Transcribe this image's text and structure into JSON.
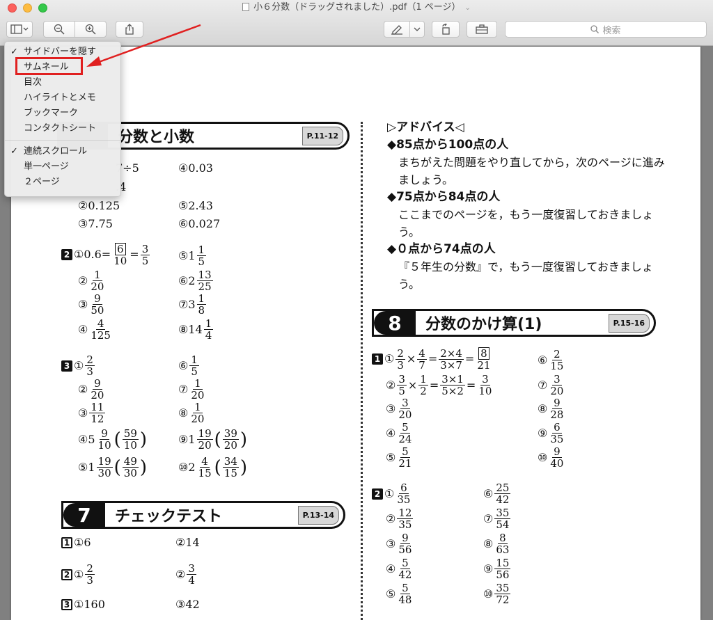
{
  "window": {
    "title": "小６分数（ドラッグされました）.pdf（1 ページ）"
  },
  "toolbar": {
    "search_placeholder": "検索"
  },
  "menu": {
    "items": [
      {
        "label": "サイドバーを隠す",
        "checked": true
      },
      {
        "label": "サムネール",
        "checked": false
      },
      {
        "label": "目次",
        "checked": false
      },
      {
        "label": "ハイライトとメモ",
        "checked": false
      },
      {
        "label": "ブックマーク",
        "checked": false
      },
      {
        "label": "コンタクトシート",
        "checked": false
      },
      {
        "label": "連続スクロール",
        "checked": true
      },
      {
        "label": "単一ページ",
        "checked": false
      },
      {
        "label": "２ページ",
        "checked": false
      }
    ],
    "check_mark": "✓"
  },
  "doc": {
    "sec6": {
      "title": "分数と小数",
      "page": "P.11-12"
    },
    "sec7": {
      "num": "7",
      "title": "チェックテスト",
      "page": "P.13-14"
    },
    "sec8": {
      "num": "8",
      "title": "分数のかけ算(1)",
      "page": "P.15-16"
    },
    "q1_top": {
      "a1": "7÷5",
      "a2": ".4",
      "a4": "④0.03",
      "b2": "②0.125",
      "b5": "⑤2.43",
      "c3": "③7.75",
      "c6": "⑥0.027"
    },
    "q2": {
      "num": "2",
      "l1": "①0.6=",
      "f1n": "6",
      "f1d": "10",
      "eq": "=",
      "f2n": "3",
      "f2d": "5",
      "r5": "⑤1",
      "r5n": "1",
      "r5d": "5",
      "l2": "②",
      "f3n": "1",
      "f3d": "20",
      "r6": "⑥2",
      "r6n": "13",
      "r6d": "25",
      "l3": "③",
      "f4n": "9",
      "f4d": "50",
      "r7": "⑦3",
      "r7n": "1",
      "r7d": "8",
      "l4": "④",
      "f5n": "4",
      "f5d": "125",
      "r8": "⑧14",
      "r8n": "1",
      "r8d": "4"
    },
    "q3": {
      "num": "3",
      "l1": "①",
      "a1n": "2",
      "a1d": "3",
      "r6": "⑥",
      "r6n": "1",
      "r6d": "5",
      "l2": "②",
      "a2n": "9",
      "a2d": "20",
      "r7": "⑦",
      "r7n": "1",
      "r7d": "20",
      "l3": "③",
      "a3n": "11",
      "a3d": "12",
      "r8": "⑧",
      "r8n": "1",
      "r8d": "20",
      "l4": "④5",
      "a4n": "9",
      "a4d": "10",
      "a4pn": "59",
      "a4pd": "10",
      "r9": "⑨1",
      "r9n": "19",
      "r9d": "20",
      "r9pn": "39",
      "r9pd": "20",
      "l5": "⑤1",
      "a5n": "19",
      "a5d": "30",
      "a5pn": "49",
      "a5pd": "30",
      "r10": "⑩2",
      "r10n": "4",
      "r10d": "15",
      "r10pn": "34",
      "r10pd": "15"
    },
    "q7": {
      "n1": "1",
      "a1": "①6",
      "a2": "②14",
      "n2": "2",
      "b1": "①",
      "b1n": "2",
      "b1d": "3",
      "b2": "②",
      "b2n": "3",
      "b2d": "4",
      "n3": "3",
      "c1": "①160",
      "c3": "③42"
    },
    "advice": {
      "title": "▷アドバイス◁",
      "h1": "◆85点から100点の人",
      "t1": "まちがえた問題をやり直してから，次のページに進みましょう。",
      "h2": "◆75点から84点の人",
      "t2": "ここまでのページを，もう一度復習しておきましょう。",
      "h3": "◆０点から74点の人",
      "t3": "『５年生の分数』で，もう一度復習しておきましょう。"
    },
    "q8_1": {
      "num": "1",
      "l1": "①",
      "e1": [
        "2",
        "3",
        "4",
        "7",
        "2×4",
        "3×7",
        "8",
        "21"
      ],
      "l2": "②",
      "e2": [
        "3",
        "5",
        "1",
        "2",
        "3×1",
        "5×2",
        "3",
        "10"
      ],
      "l3": "③",
      "f3n": "3",
      "f3d": "20",
      "l4": "④",
      "f4n": "5",
      "f4d": "24",
      "l5": "⑤",
      "f5n": "5",
      "f5d": "21",
      "r6": "⑥",
      "r6n": "2",
      "r6d": "15",
      "r7": "⑦",
      "r7n": "3",
      "r7d": "20",
      "r8": "⑧",
      "r8n": "9",
      "r8d": "28",
      "r9": "⑨",
      "r9n": "6",
      "r9d": "35",
      "r10": "⑩",
      "r10n": "9",
      "r10d": "40"
    },
    "q8_2": {
      "num": "2",
      "l1": "①",
      "f1n": "6",
      "f1d": "35",
      "l2": "②",
      "f2n": "12",
      "f2d": "35",
      "l3": "③",
      "f3n": "9",
      "f3d": "56",
      "l4": "④",
      "f4n": "5",
      "f4d": "42",
      "l5": "⑤",
      "f5n": "5",
      "f5d": "48",
      "r6": "⑥",
      "r6n": "25",
      "r6d": "42",
      "r7": "⑦",
      "r7n": "35",
      "r7d": "54",
      "r8": "⑧",
      "r8n": "8",
      "r8d": "63",
      "r9": "⑨",
      "r9n": "15",
      "r9d": "56",
      "r10": "⑩",
      "r10n": "35",
      "r10d": "72"
    }
  },
  "colors": {
    "annotation_red": "#e02020"
  }
}
